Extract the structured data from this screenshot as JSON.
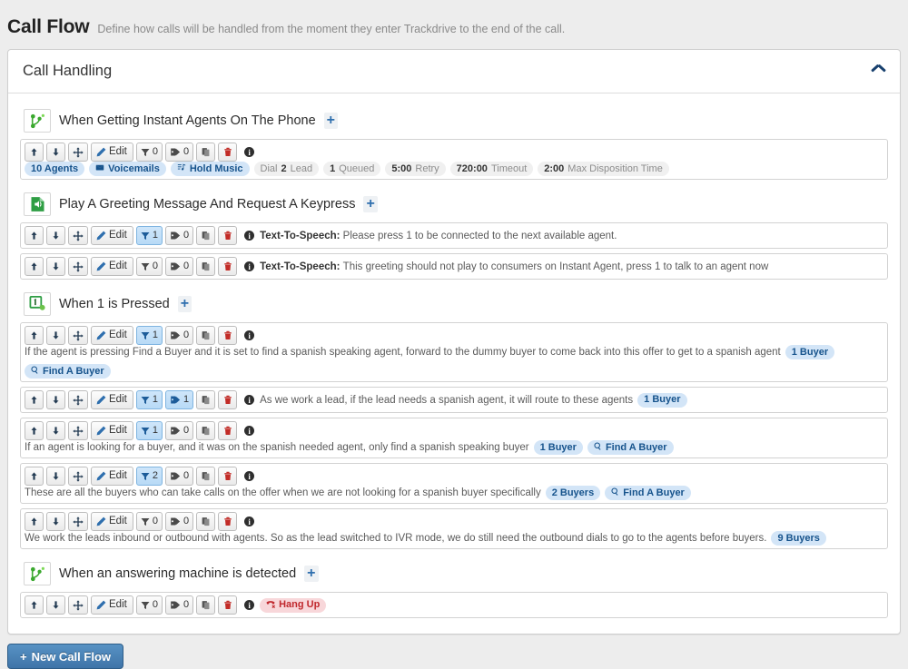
{
  "page": {
    "title": "Call Flow",
    "subtitle": "Define how calls will be handled from the moment they enter Trackdrive to the end of the call."
  },
  "panel": {
    "title": "Call Handling",
    "collapse_icon": "chevron-up-icon"
  },
  "buttons": {
    "move_up": "↑",
    "move_down": "↓",
    "drag": "move-icon",
    "edit": "Edit",
    "filter_icon": "filter-icon",
    "tag_icon": "tag-icon",
    "copy_icon": "copy-icon",
    "delete_icon": "trash-icon",
    "info_icon": "i"
  },
  "footer": {
    "new_call_flow": "New Call Flow",
    "plus": "+"
  },
  "groups": [
    {
      "icon": "call-flow-node-icon",
      "title": "When Getting Instant Agents On The Phone",
      "add": "+",
      "rows": [
        {
          "filter_count": "0",
          "filter_active": false,
          "tag_count": "0",
          "tag_active": false,
          "desc": "",
          "badges": [
            {
              "style": "blue",
              "icon": "",
              "text": "10 Agents"
            },
            {
              "style": "blue",
              "icon": "envelope-icon",
              "text": "Voicemails"
            },
            {
              "style": "blue",
              "icon": "music-icon",
              "text": "Hold Music"
            },
            {
              "style": "gray",
              "icon": "",
              "pre": "Dial",
              "num": "2",
              "post": "Lead"
            },
            {
              "style": "gray",
              "icon": "",
              "pre": "",
              "num": "1",
              "post": "Queued"
            },
            {
              "style": "gray",
              "icon": "",
              "pre": "",
              "num": "5:00",
              "post": "Retry"
            },
            {
              "style": "gray",
              "icon": "",
              "pre": "",
              "num": "720:00",
              "post": "Timeout"
            },
            {
              "style": "gray",
              "icon": "",
              "pre": "",
              "num": "2:00",
              "post": "Max Disposition Time"
            }
          ]
        }
      ]
    },
    {
      "icon": "audio-file-icon",
      "title": "Play A Greeting Message And Request A Keypress",
      "add": "+",
      "rows": [
        {
          "filter_count": "1",
          "filter_active": true,
          "tag_count": "0",
          "tag_active": false,
          "label": "Text-To-Speech:",
          "desc": "Please press 1 to be connected to the next available agent.",
          "badges": []
        },
        {
          "filter_count": "0",
          "filter_active": false,
          "tag_count": "0",
          "tag_active": false,
          "label": "Text-To-Speech:",
          "desc": "This greeting should not play to consumers on Instant Agent, press 1 to talk to an agent now",
          "badges": []
        }
      ]
    },
    {
      "icon": "keypad-one-icon",
      "title": "When 1 is Pressed",
      "add": "+",
      "rows": [
        {
          "filter_count": "1",
          "filter_active": true,
          "tag_count": "0",
          "tag_active": false,
          "desc": "If the agent is pressing Find a Buyer and it is set to find a spanish speaking agent, forward to the dummy buyer to come back into this offer to get to a spanish agent",
          "badges": [
            {
              "style": "blue",
              "icon": "",
              "text": "1 Buyer"
            },
            {
              "style": "blue",
              "icon": "search-icon",
              "text": "Find A Buyer"
            }
          ]
        },
        {
          "filter_count": "1",
          "filter_active": true,
          "tag_count": "1",
          "tag_active": true,
          "desc": "As we work a lead, if the lead needs a spanish agent, it will route to these agents",
          "badges": [
            {
              "style": "blue",
              "icon": "",
              "text": "1 Buyer"
            }
          ]
        },
        {
          "filter_count": "1",
          "filter_active": true,
          "tag_count": "0",
          "tag_active": false,
          "desc": "If an agent is looking for a buyer, and it was on the spanish needed agent, only find a spanish speaking buyer",
          "badges": [
            {
              "style": "blue",
              "icon": "",
              "text": "1 Buyer"
            },
            {
              "style": "blue",
              "icon": "search-icon",
              "text": "Find A Buyer"
            }
          ]
        },
        {
          "filter_count": "2",
          "filter_active": true,
          "tag_count": "0",
          "tag_active": false,
          "desc": "These are all the buyers who can take calls on the offer when we are not looking for a spanish buyer specifically",
          "badges": [
            {
              "style": "blue",
              "icon": "",
              "text": "2 Buyers"
            },
            {
              "style": "blue",
              "icon": "search-icon",
              "text": "Find A Buyer"
            }
          ]
        },
        {
          "filter_count": "0",
          "filter_active": false,
          "tag_count": "0",
          "tag_active": false,
          "desc": "We work the leads inbound or outbound with agents. So as the lead switched to IVR mode, we do still need the outbound dials to go to the agents before buyers.",
          "badges": [
            {
              "style": "blue",
              "icon": "",
              "text": "9 Buyers"
            }
          ]
        }
      ]
    },
    {
      "icon": "call-flow-node-icon",
      "title": "When an answering machine is detected",
      "add": "+",
      "rows": [
        {
          "filter_count": "0",
          "filter_active": false,
          "tag_count": "0",
          "tag_active": false,
          "desc": "",
          "badges": [
            {
              "style": "red",
              "icon": "hangup-icon",
              "text": "Hang Up"
            }
          ]
        }
      ]
    }
  ]
}
